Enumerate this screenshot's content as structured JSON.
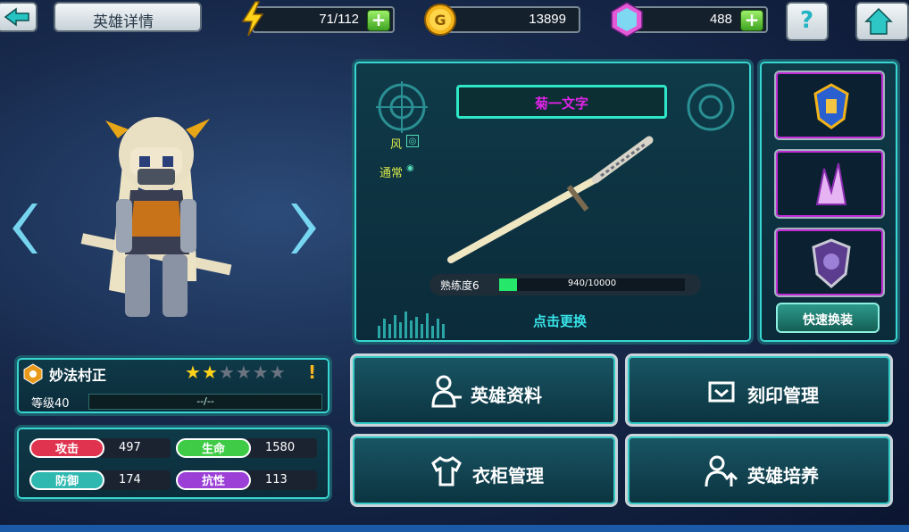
{
  "header": {
    "title": "英雄详情",
    "energy": "71/112",
    "gold": "13899",
    "gems": "488",
    "help": "?"
  },
  "weapon": {
    "name": "菊一文字",
    "element": "风",
    "rarity": "通常",
    "proficiency_label": "熟练度6",
    "proficiency_value": "940/10000",
    "proficiency_fraction": 0.094,
    "change_label": "点击更换"
  },
  "equip": {
    "quick_label": "快速换装"
  },
  "hero": {
    "name": "妙法村正",
    "stars": 2,
    "max_stars": 6,
    "level": "等级40",
    "exp": "--/--"
  },
  "stats": [
    {
      "label": "攻击",
      "value": "497",
      "color": "#e0334f"
    },
    {
      "label": "生命",
      "value": "1580",
      "color": "#3fcb46"
    },
    {
      "label": "防御",
      "value": "174",
      "color": "#2fb8b0"
    },
    {
      "label": "抗性",
      "value": "113",
      "color": "#9b3fd6"
    }
  ],
  "actions": {
    "info": "英雄资料",
    "seal": "刻印管理",
    "wardrobe": "衣柜管理",
    "train": "英雄培养"
  }
}
